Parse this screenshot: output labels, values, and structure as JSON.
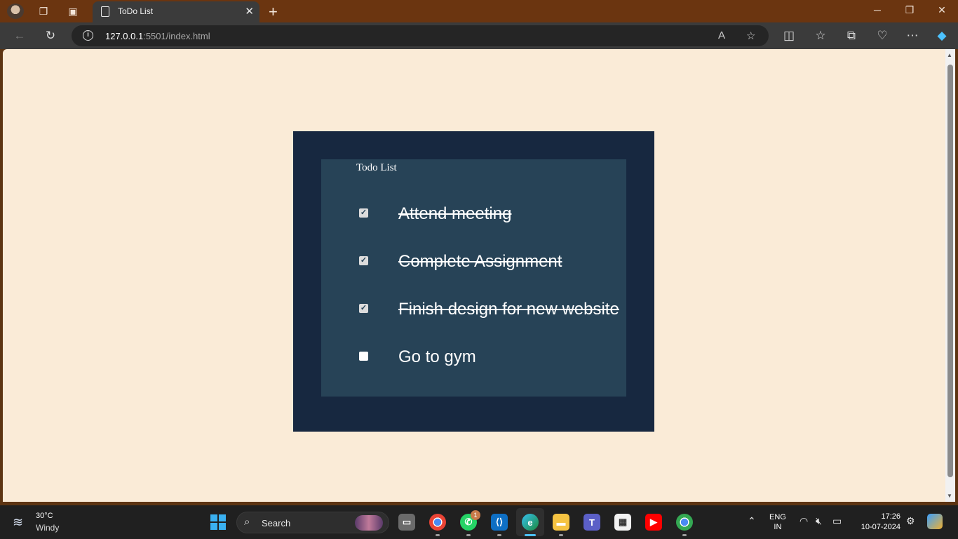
{
  "browser": {
    "tab_title": "ToDo List",
    "url_host": "127.0.0.1",
    "url_rest": ":5501/index.html"
  },
  "page": {
    "heading": "Todo List",
    "todos": [
      {
        "text": "Attend meeting",
        "checked": true
      },
      {
        "text": "Complete Assignment",
        "checked": true
      },
      {
        "text": "Finish design for new website",
        "checked": true
      },
      {
        "text": "Go to gym",
        "checked": false
      }
    ],
    "colors": {
      "background": "#faebd7",
      "outer_box": "#172840",
      "inner_box": "#274357",
      "text": "#ffffff"
    }
  },
  "taskbar": {
    "weather_temp": "30°C",
    "weather_cond": "Windy",
    "search_label": "Search",
    "whatsapp_badge": "1",
    "lang_line1": "ENG",
    "lang_line2": "IN",
    "time": "17:26",
    "date": "10-07-2024"
  }
}
